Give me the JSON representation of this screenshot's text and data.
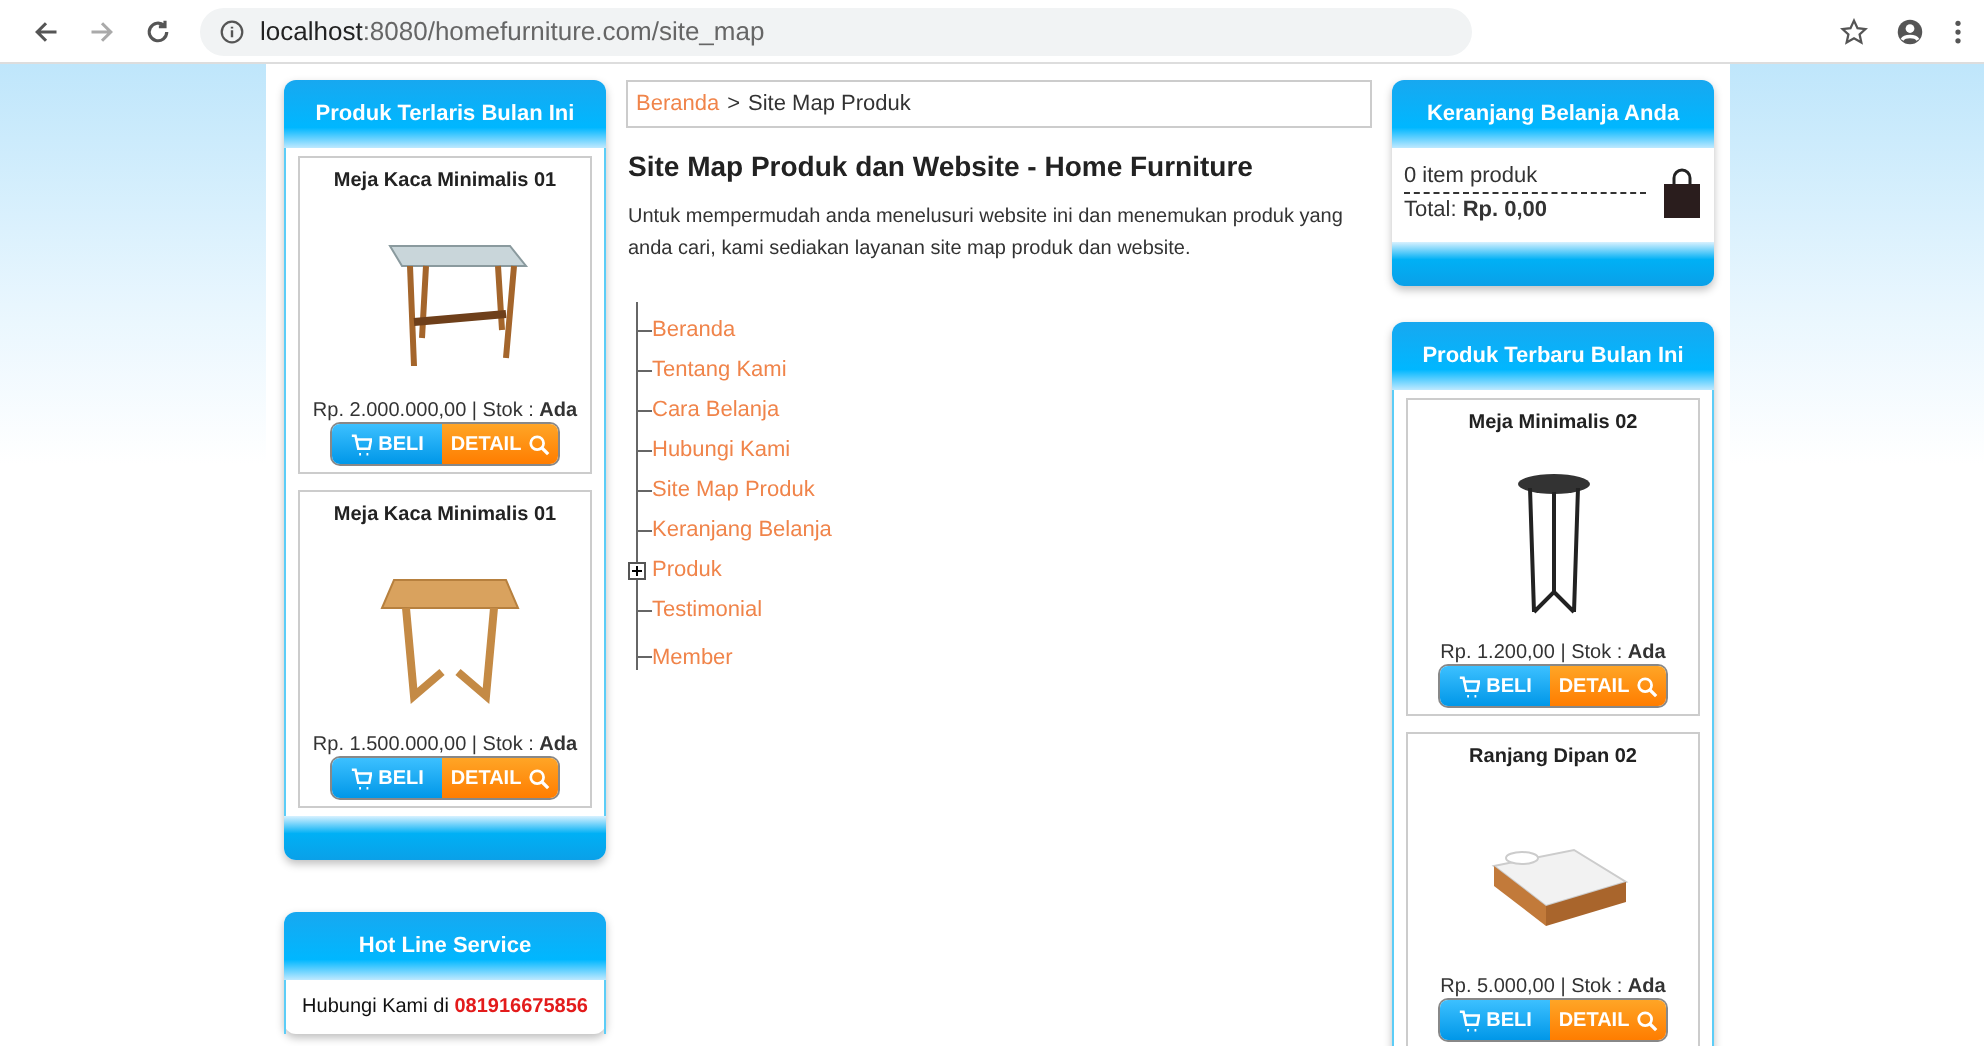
{
  "browser": {
    "url_host": "localhost",
    "url_path": ":8080/homefurniture.com/site_map"
  },
  "left": {
    "bestseller": {
      "title": "Produk Terlaris Bulan Ini",
      "products": [
        {
          "name": "Meja Kaca Minimalis 01",
          "kind": "glass-table",
          "price": "Rp. 2.000.000,00 | Stok : **Ada**",
          "buy": "BELI",
          "detail": "DETAIL"
        },
        {
          "name": "Meja Kaca Minimalis 01",
          "kind": "wood-table",
          "price": "Rp. 1.500.000,00 | Stok : **Ada**",
          "buy": "BELI",
          "detail": "DETAIL"
        }
      ]
    },
    "hotline": {
      "title": "Hot Line Service",
      "label": "Hubungi Kami di",
      "phone": "081916675856"
    }
  },
  "main": {
    "breadcrumb": [
      {
        "label": "Beranda",
        "kind": "link"
      },
      {
        "label": ">",
        "kind": "separator"
      },
      {
        "label": "Site Map Produk",
        "kind": "current"
      }
    ],
    "title": "Site Map Produk dan Website - Home Furniture",
    "intro": "Untuk mempermudah anda menelusuri website ini dan menemukan produk yang anda cari, kami sediakan layanan site map produk dan website.",
    "tree": [
      {
        "label": "Beranda"
      },
      {
        "label": "Tentang Kami"
      },
      {
        "label": "Cara Belanja"
      },
      {
        "label": "Hubungi Kami"
      },
      {
        "label": "Site Map Produk"
      },
      {
        "label": "Keranjang Belanja"
      },
      {
        "label": "Produk",
        "expanded": false
      },
      {
        "label": "Testimonial"
      },
      {
        "label": "Member"
      }
    ]
  },
  "right": {
    "cart": {
      "title": "Keranjang Belanja Anda",
      "items": "0 item produk",
      "total_label": "Total:",
      "total": "Rp. 0,00"
    },
    "newest": {
      "title": "Produk Terbaru Bulan Ini",
      "products": [
        {
          "name": "Meja Minimalis 02",
          "kind": "stool",
          "price": "Rp. 1.200,00 | Stok : **Ada**",
          "buy": "BELI",
          "detail": "DETAIL"
        },
        {
          "name": "Ranjang Dipan 02",
          "kind": "bed",
          "price": "Rp. 5.000,00 | Stok : **Ada**",
          "buy": "BELI",
          "detail": "DETAIL"
        }
      ]
    }
  }
}
